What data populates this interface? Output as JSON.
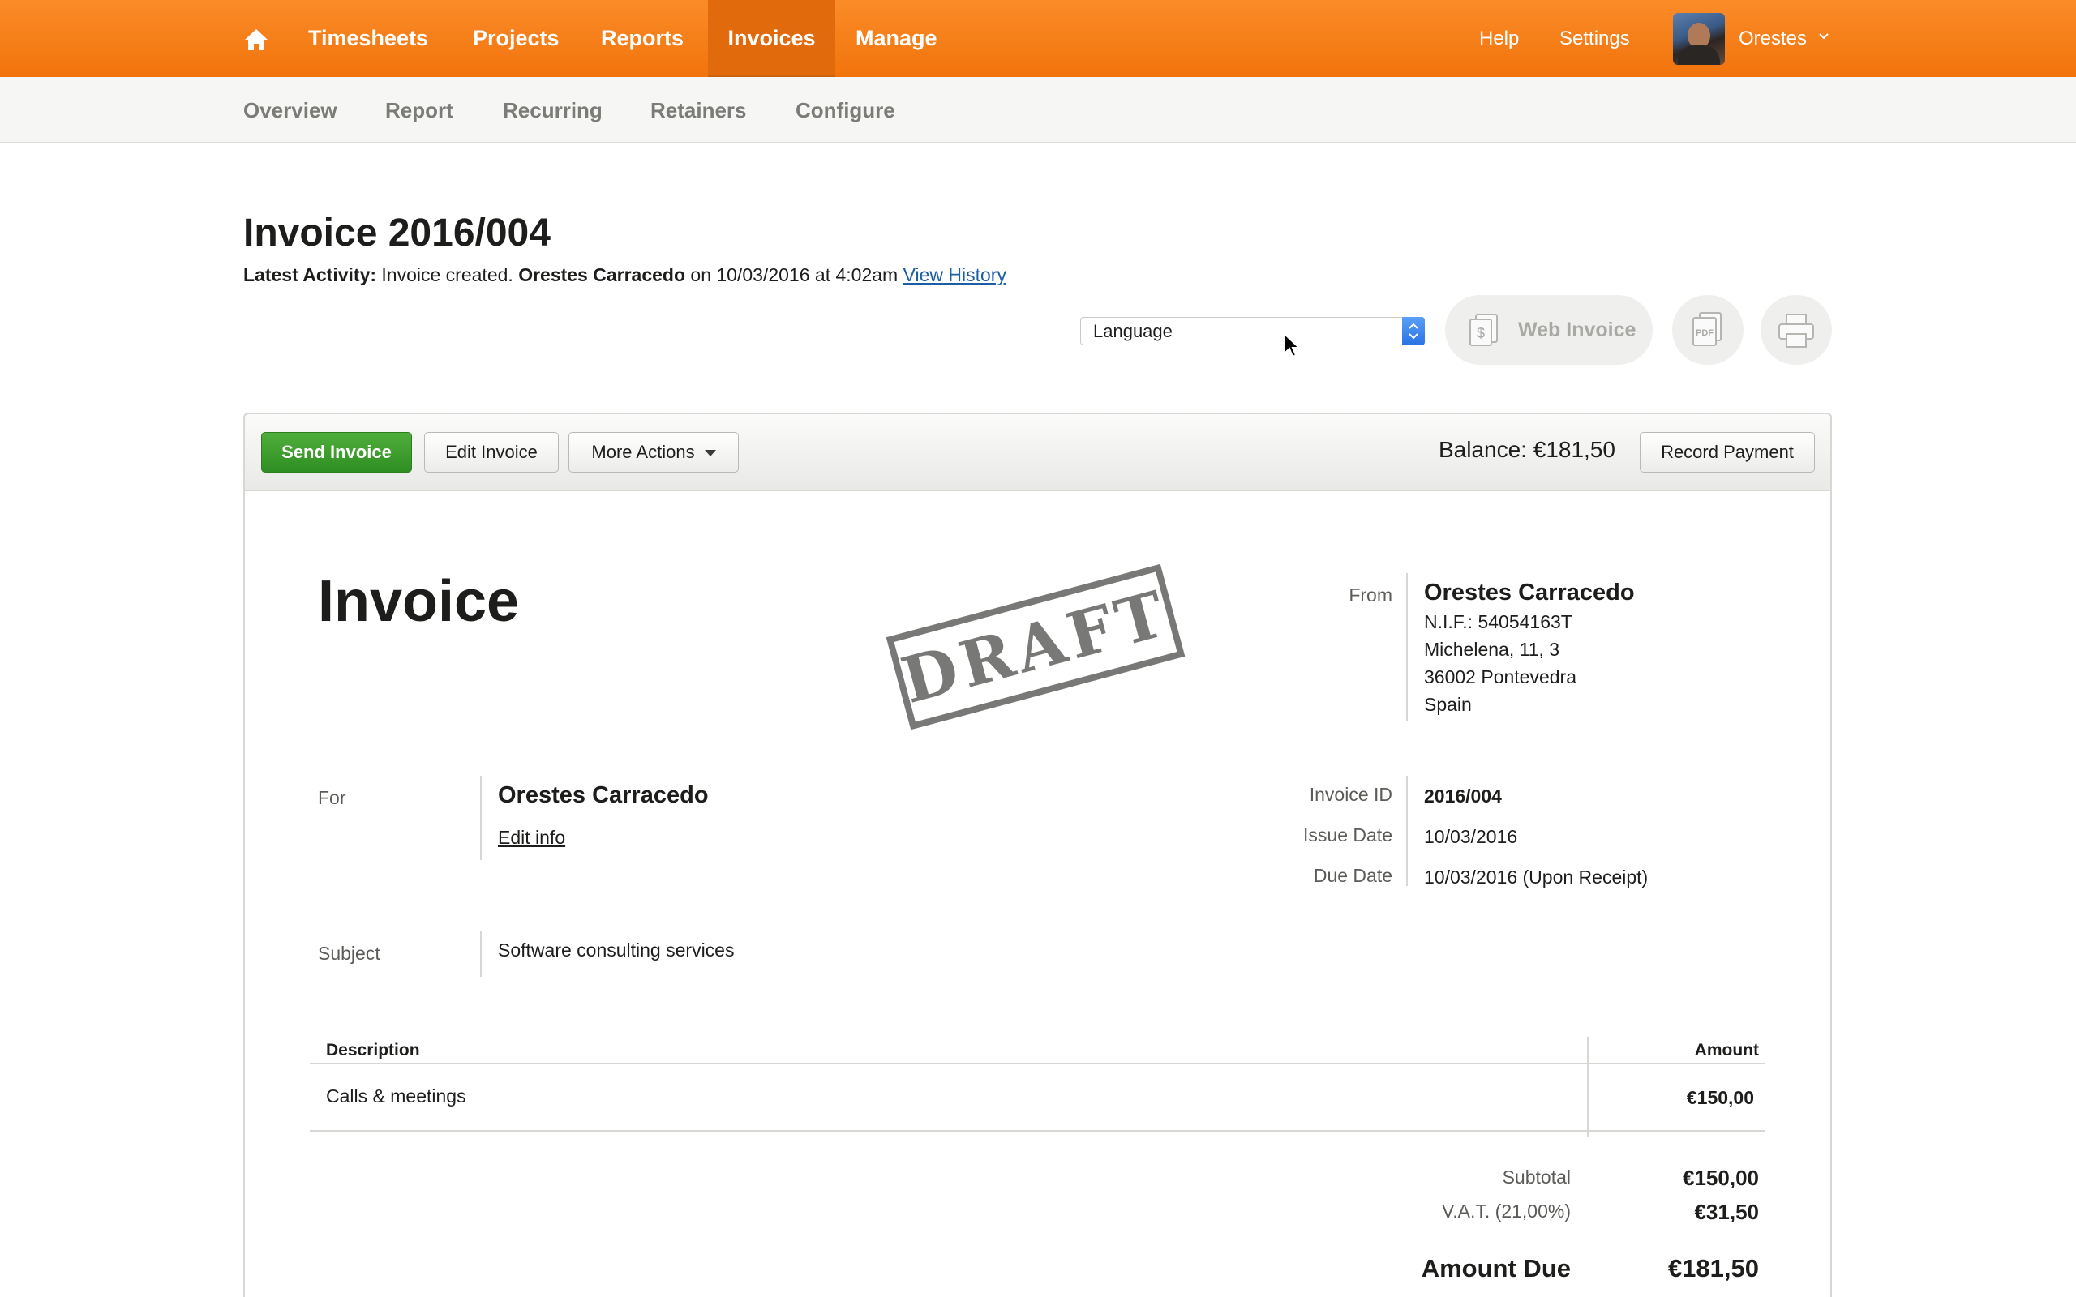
{
  "topnav": {
    "items": [
      {
        "label": "Timesheets",
        "active": false
      },
      {
        "label": "Projects",
        "active": false
      },
      {
        "label": "Reports",
        "active": false
      },
      {
        "label": "Invoices",
        "active": true
      },
      {
        "label": "Manage",
        "active": false
      }
    ],
    "help_label": "Help",
    "settings_label": "Settings",
    "user_name": "Orestes"
  },
  "subnav": {
    "items": [
      "Overview",
      "Report",
      "Recurring",
      "Retainers",
      "Configure"
    ]
  },
  "header": {
    "title": "Invoice 2016/004",
    "activity_prefix": "Latest Activity:",
    "activity_text": "Invoice created.",
    "activity_user": "Orestes Carracedo",
    "activity_when": "on 10/03/2016 at 4:02am",
    "view_history_label": "View History",
    "language_label": "Language",
    "web_invoice_label": "Web Invoice",
    "pdf_label": "PDF"
  },
  "toolbar": {
    "send_label": "Send Invoice",
    "edit_label": "Edit Invoice",
    "more_label": "More Actions",
    "balance_text": "Balance: €181,50",
    "record_payment_label": "Record Payment"
  },
  "invoice": {
    "heading": "Invoice",
    "stamp_text": "DRAFT",
    "from_label": "From",
    "from": {
      "name": "Orestes Carracedo",
      "lines": [
        "N.I.F.: 54054163T",
        "Michelena, 11, 3",
        "36002 Pontevedra",
        "Spain"
      ]
    },
    "for_label": "For",
    "for_name": "Orestes Carracedo",
    "edit_info_label": "Edit info",
    "invoice_id_label": "Invoice ID",
    "invoice_id": "2016/004",
    "issue_date_label": "Issue Date",
    "issue_date": "10/03/2016",
    "due_date_label": "Due Date",
    "due_date": "10/03/2016 (Upon Receipt)",
    "subject_label": "Subject",
    "subject": "Software consulting services",
    "table": {
      "col_description": "Description",
      "col_amount": "Amount",
      "rows": [
        {
          "description": "Calls & meetings",
          "amount": "€150,00"
        }
      ]
    },
    "subtotal_label": "Subtotal",
    "subtotal": "€150,00",
    "vat_label": "V.A.T. (21,00%)",
    "vat": "€31,50",
    "amount_due_label": "Amount Due",
    "amount_due": "€181,50"
  },
  "colors": {
    "nav_orange": "#f57f17",
    "nav_active": "#e06a0c",
    "send_green": "#3c9d2c",
    "link_blue": "#1a5ea6"
  }
}
